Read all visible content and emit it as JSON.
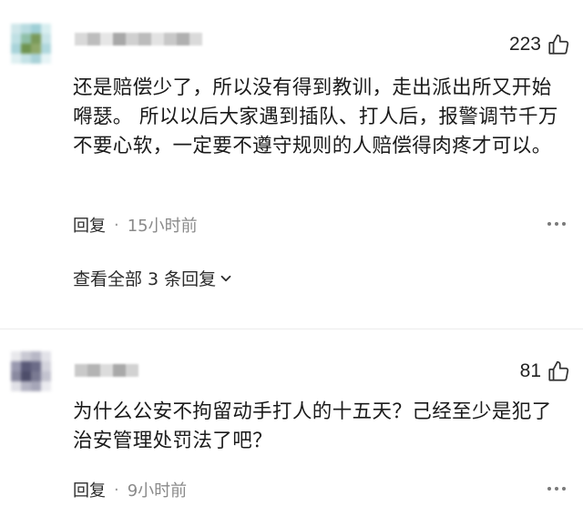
{
  "comments": [
    {
      "likes": "223",
      "text": "还是赔偿少了，所以没有得到教训，走出派出所又开始嘚瑟。 所以以后大家遇到插队、打人后，报警调节千万不要心软，一定要不遵守规则的人赔偿得肉疼才可以。",
      "reply_label": "回复",
      "separator": "·",
      "time": "15小时前",
      "view_all_label": "查看全部 3 条回复",
      "avatar_colors": [
        "#cfe7ea",
        "#b8dbe0",
        "#9fcfd6",
        "#d8eef0",
        "#bfe0e4",
        "#8fbfa8",
        "#7a9a5a",
        "#c8e4e8",
        "#a9d4da",
        "#6f9450",
        "#8fa86a",
        "#b0d8de",
        "#dff0f2",
        "#c4e2e6",
        "#aad2d8",
        "#e6f4f6"
      ],
      "username_colors": [
        "#d9d9d9",
        "#bdbdbd",
        "#e6e6e6",
        "#a8a8a8",
        "#d0d0d0",
        "#bcbcbc",
        "#e3e3e3",
        "#c8c8c8",
        "#b0b0b0",
        "#dadada"
      ]
    },
    {
      "likes": "81",
      "text": "为什么公安不拘留动手打人的十五天？己经至少是犯了治安管理处罚法了吧？",
      "reply_label": "回复",
      "separator": "·",
      "time": "9小时前",
      "avatar_colors": [
        "#e8e8ec",
        "#c9c9d3",
        "#b8b8c6",
        "#e2e2e8",
        "#9a9ab0",
        "#5a5a78",
        "#6c6c88",
        "#d3d3dc",
        "#8a8aa0",
        "#4e4e6a",
        "#7a7a92",
        "#c3c3cf",
        "#e1e1e7",
        "#b5b5c4",
        "#a6a6b8",
        "#ebebef"
      ],
      "username_colors": [
        "#c9c9c9",
        "#b4b4b4",
        "#dcdcdc",
        "#a9a9a9",
        "#d2d2d2"
      ]
    }
  ]
}
